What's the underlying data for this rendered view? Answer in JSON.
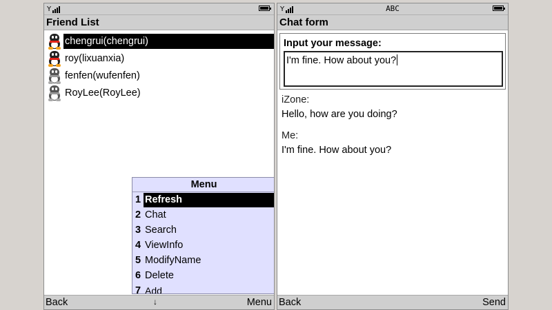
{
  "left_screen": {
    "title": "Friend List",
    "friends": [
      {
        "label": "chengrui(chengrui)",
        "selected": true
      },
      {
        "label": "roy(lixuanxia)",
        "selected": false
      },
      {
        "label": "fenfen(wufenfen)",
        "selected": false
      },
      {
        "label": "RoyLee(RoyLee)",
        "selected": false
      }
    ],
    "menu": {
      "title": "Menu",
      "items": [
        {
          "num": "1",
          "label": "Refresh"
        },
        {
          "num": "2",
          "label": "Chat"
        },
        {
          "num": "3",
          "label": "Search"
        },
        {
          "num": "4",
          "label": "ViewInfo"
        },
        {
          "num": "5",
          "label": "ModifyName"
        },
        {
          "num": "6",
          "label": "Delete"
        },
        {
          "num": "7",
          "label": "Add"
        }
      ]
    },
    "softkeys": {
      "left": "Back",
      "middle": "↓",
      "right": "Menu"
    }
  },
  "right_screen": {
    "status_input_mode": "ABC",
    "title": "Chat form",
    "form": {
      "label": "Input your message:",
      "input_value": "I'm fine. How about you?"
    },
    "messages": [
      {
        "sender": "iZone:",
        "text": "Hello, how are you doing?"
      },
      {
        "sender": "Me:",
        "text": "I'm fine. How about you?"
      }
    ],
    "softkeys": {
      "left": "Back",
      "right": "Send"
    }
  },
  "colors": {
    "background": "#d7d3cf",
    "chrome_gray": "#cfcfcf",
    "menu_bg": "#e0e0ff",
    "selection": "#000000"
  },
  "icons": [
    "signal-icon",
    "battery-icon",
    "qq-penguin-icon",
    "down-arrow-icon"
  ]
}
